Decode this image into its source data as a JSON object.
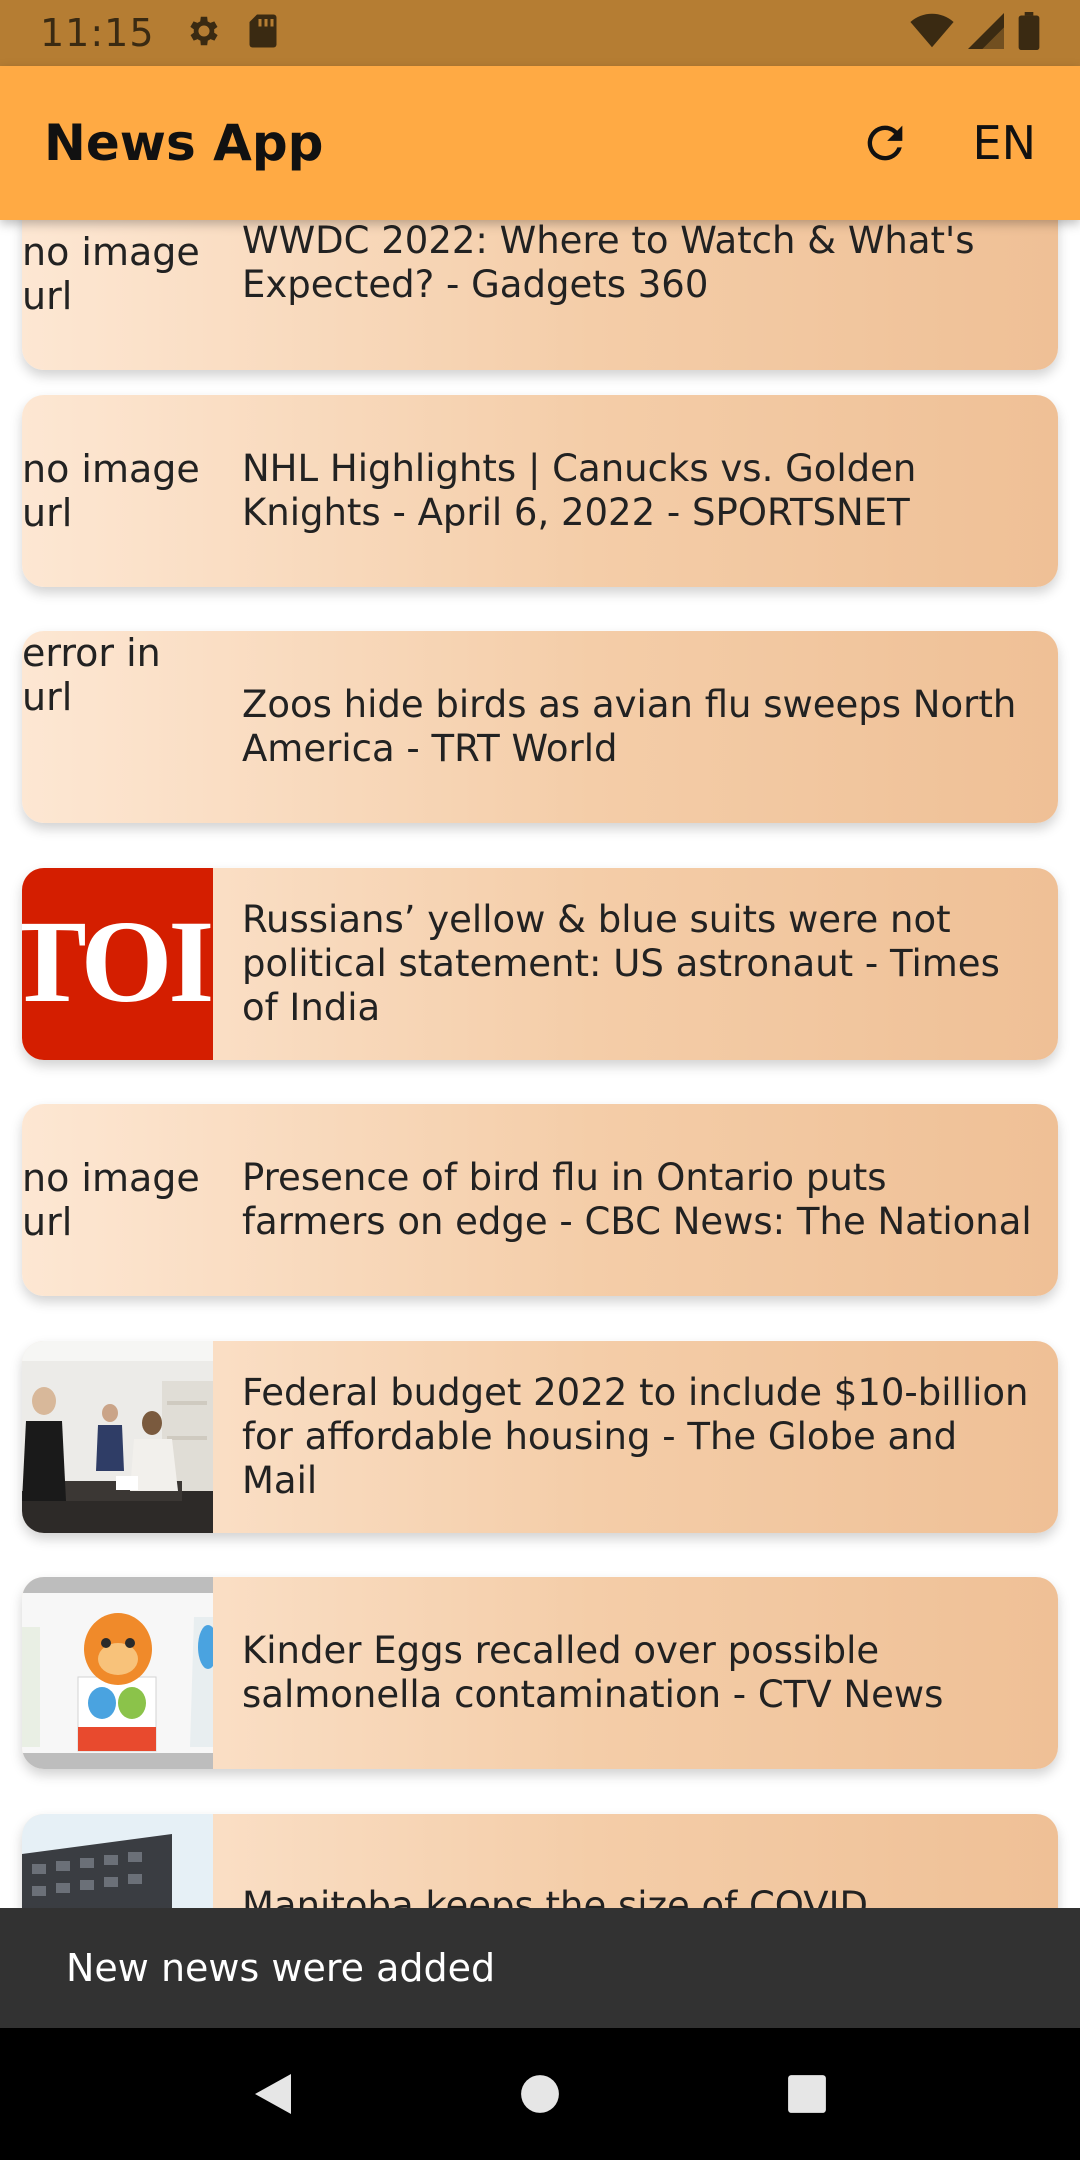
{
  "status_bar": {
    "time": "11:15",
    "left_icons": [
      "gear-icon",
      "sd-card-icon"
    ],
    "right_icons": [
      "wifi-icon",
      "signal-icon",
      "battery-icon"
    ]
  },
  "app_bar": {
    "title": "News App",
    "refresh_icon": "refresh-icon",
    "language": "EN",
    "color": "#ffaa44"
  },
  "news": [
    {
      "thumb_type": "text",
      "thumb_text": "no image\nurl",
      "headline": "WWDC 2022: Where to Watch & What's Expected? - Gadgets 360"
    },
    {
      "thumb_type": "text",
      "thumb_text": "no image\nurl",
      "headline": "NHL Highlights | Canucks vs. Golden Knights - April 6, 2022 - SPORTSNET"
    },
    {
      "thumb_type": "text",
      "thumb_text": "error in url",
      "headline": "Zoos hide birds as avian flu sweeps North America - TRT World"
    },
    {
      "thumb_type": "logo",
      "thumb_text": "TOI",
      "headline": "Russians’ yellow & blue suits were not political statement: US astronaut - Times of India"
    },
    {
      "thumb_type": "text",
      "thumb_text": "no image\nurl",
      "headline": "Presence of bird flu in Ontario puts farmers on edge - CBC News: The National"
    },
    {
      "thumb_type": "photo",
      "thumb_text": "",
      "headline": "Federal budget 2022 to include $10-billion for affordable housing - The Globe and Mail"
    },
    {
      "thumb_type": "photo",
      "thumb_text": "",
      "headline": "Kinder Eggs recalled over possible salmonella contamination - CTV News"
    },
    {
      "thumb_type": "photo",
      "thumb_text": "",
      "headline": "Manitoba keeps the size of COVID outbreaks at"
    }
  ],
  "snackbar": {
    "message": "New news were added"
  },
  "nav_bar": {
    "icons": [
      "back-icon",
      "home-icon",
      "recents-icon"
    ]
  },
  "colors": {
    "status_bar": "#b57d33",
    "card_gradient_start": "#fde7d3",
    "card_gradient_end": "#efc096",
    "toi_red": "#d41e00"
  }
}
